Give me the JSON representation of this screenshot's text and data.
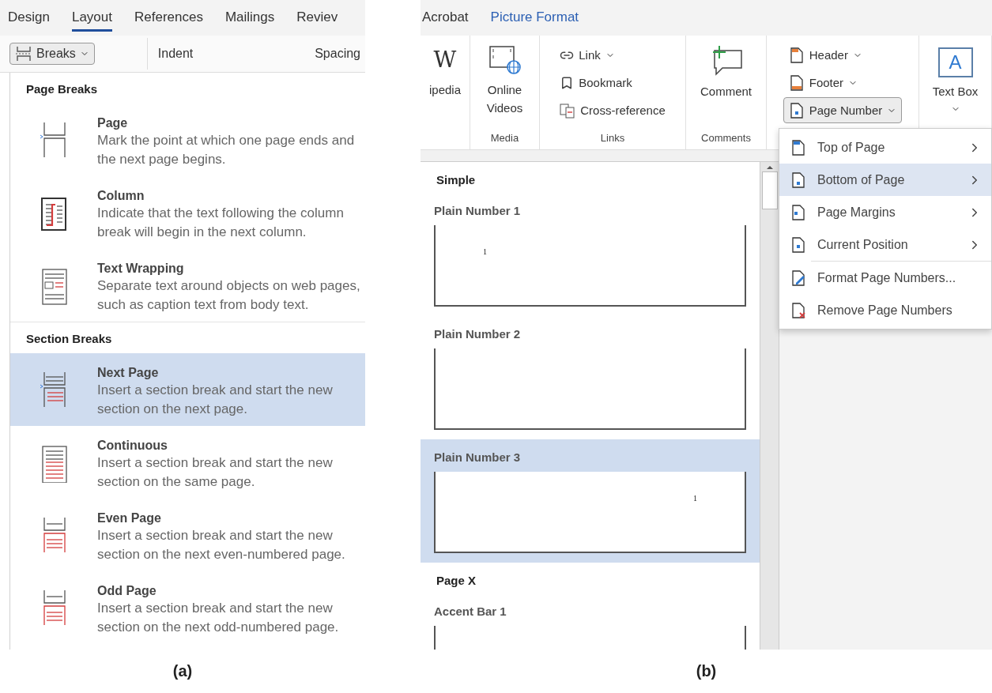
{
  "panel_a": {
    "tabs": [
      {
        "label": "Design",
        "selected": false
      },
      {
        "label": "Layout",
        "selected": true
      },
      {
        "label": "References",
        "selected": false
      },
      {
        "label": "Mailings",
        "selected": false
      },
      {
        "label": "Reviev",
        "selected": false
      }
    ],
    "toolbar": {
      "breaks_button": {
        "label": "Breaks",
        "pressed": true
      },
      "indent_label": "Indent",
      "spacing_label": "Spacing"
    },
    "sections": [
      {
        "heading": "Page Breaks",
        "items": [
          {
            "kind": "page",
            "title": "Page",
            "description": "Mark the point at which one page ends and the next page begins.",
            "selected": false
          },
          {
            "kind": "column",
            "title": "Column",
            "description": "Indicate that the text following the column break will begin in the next column.",
            "selected": false
          },
          {
            "kind": "text-wrapping",
            "title": "Text Wrapping",
            "description": "Separate text around objects on web pages, such as caption text from body text.",
            "selected": false
          }
        ]
      },
      {
        "heading": "Section Breaks",
        "items": [
          {
            "kind": "next-page",
            "title": "Next Page",
            "description": "Insert a section break and start the new section on the next page.",
            "selected": true
          },
          {
            "kind": "continuous",
            "title": "Continuous",
            "description": "Insert a section break and start the new section on the same page.",
            "selected": false
          },
          {
            "kind": "even-page",
            "title": "Even Page",
            "description": "Insert a section break and start the new section on the next even-numbered page.",
            "selected": false
          },
          {
            "kind": "odd-page",
            "title": "Odd Page",
            "description": "Insert a section break and start the new section on the next odd-numbered page.",
            "selected": false
          }
        ]
      }
    ],
    "caption": "(a)"
  },
  "panel_b": {
    "tabs": [
      {
        "label": "Acrobat",
        "selected": false
      },
      {
        "label": "Picture Format",
        "selected": true
      }
    ],
    "ribbon": [
      {
        "kind": "large",
        "items": [
          {
            "kind": "wikipedia",
            "icon_text": "W",
            "label": "ipedia",
            "dropdown": false,
            "pressed": false
          }
        ]
      },
      {
        "kind": "large",
        "group_label": "Media",
        "items": [
          {
            "kind": "video",
            "label": "Online Videos",
            "dropdown": false,
            "pressed": false
          }
        ]
      },
      {
        "kind": "stacked",
        "group_label": "Links",
        "items": [
          {
            "kind": "link",
            "label": "Link",
            "dropdown": true,
            "pressed": false
          },
          {
            "kind": "bookmark",
            "label": "Bookmark",
            "dropdown": false,
            "pressed": false
          },
          {
            "kind": "cross-reference",
            "label": "Cross-reference",
            "dropdown": false,
            "pressed": false
          }
        ]
      },
      {
        "kind": "large",
        "group_label": "Comments",
        "items": [
          {
            "kind": "comment",
            "label": "Comment",
            "dropdown": false,
            "pressed": false
          }
        ]
      },
      {
        "kind": "stacked",
        "items": [
          {
            "kind": "header",
            "label": "Header",
            "dropdown": true,
            "pressed": false
          },
          {
            "kind": "footer",
            "label": "Footer",
            "dropdown": true,
            "pressed": false
          },
          {
            "kind": "page-number",
            "label": "Page Number",
            "dropdown": true,
            "pressed": true
          }
        ]
      },
      {
        "kind": "large",
        "items": [
          {
            "kind": "text-box",
            "icon_text": "A",
            "label": "Text Box",
            "dropdown": true,
            "pressed": false
          }
        ]
      }
    ],
    "gallery": [
      {
        "kind": "heading",
        "label": "Simple"
      },
      {
        "kind": "plain-left",
        "label": "Plain Number 1",
        "number": "1",
        "selected": false
      },
      {
        "kind": "plain-center",
        "label": "Plain Number 2",
        "selected": false
      },
      {
        "kind": "plain-right",
        "label": "Plain Number 3",
        "number": "1",
        "selected": true
      },
      {
        "kind": "heading",
        "label": "Page X"
      },
      {
        "kind": "accent-bar",
        "label": "Accent Bar 1",
        "selected": false
      }
    ],
    "page_number_menu": [
      {
        "kind": "top",
        "label": "Top of Page",
        "submenu": true,
        "selected": false
      },
      {
        "kind": "bottom",
        "label": "Bottom of Page",
        "submenu": true,
        "selected": true
      },
      {
        "kind": "margins",
        "label": "Page Margins",
        "submenu": true,
        "selected": false
      },
      {
        "kind": "current",
        "label": "Current Position",
        "submenu": true,
        "selected": false
      },
      {
        "kind": "format",
        "label": "Format Page Numbers...",
        "submenu": false,
        "selected": false
      },
      {
        "kind": "remove",
        "label": "Remove Page Numbers",
        "submenu": false,
        "selected": false
      }
    ],
    "caption": "(b)"
  }
}
